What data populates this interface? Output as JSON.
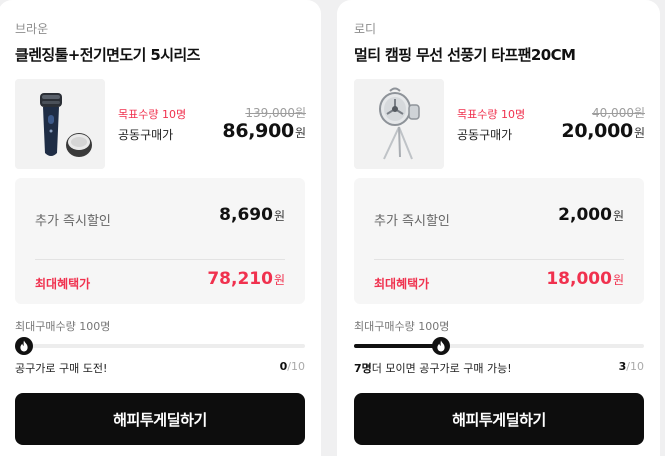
{
  "products": [
    {
      "brand": "브라운",
      "title": "클렌징툴+전기면도기 5시리즈",
      "image_icon": "electric-shaver-icon",
      "target_label": "목표수량 10명",
      "group_label": "공동구매가",
      "original_price": "139,000원",
      "group_price": "86,900",
      "currency": "원",
      "extra_discount_label": "추가 즉시할인",
      "extra_discount_value": "8,690",
      "max_benefit_label": "최대혜택가",
      "max_benefit_value": "78,210",
      "limit_label": "최대구매수량 100명",
      "progress_fraction": 0.0,
      "status_prefix": "",
      "status_text": "공구가로 구매 도전!",
      "count_current": "0",
      "count_total": "/10",
      "cta_label": "해피투게딜하기"
    },
    {
      "brand": "로디",
      "title": "멀티 캠핑 무선 선풍기 타프팬20CM",
      "image_icon": "camping-fan-icon",
      "target_label": "목표수량 10명",
      "group_label": "공동구매가",
      "original_price": "40,000원",
      "group_price": "20,000",
      "currency": "원",
      "extra_discount_label": "추가 즉시할인",
      "extra_discount_value": "2,000",
      "max_benefit_label": "최대혜택가",
      "max_benefit_value": "18,000",
      "limit_label": "최대구매수량 100명",
      "progress_fraction": 0.3,
      "status_prefix": "7명",
      "status_text": "더 모이면 공구가로 구매 가능!",
      "count_current": "3",
      "count_total": "/10",
      "cta_label": "해피투게딜하기"
    }
  ],
  "colors": {
    "accent_red": "#f0314e",
    "button_black": "#0d0d0d",
    "page_background": "#f0f0f1"
  }
}
